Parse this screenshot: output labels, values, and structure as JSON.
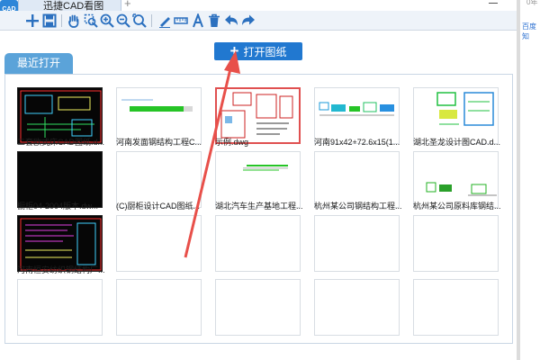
{
  "app": {
    "logo_text": "CAD",
    "tab_title": "迅捷CAD看图",
    "new_tab": "+",
    "side_fragment_1": "0年",
    "side_fragment_2": "百度知"
  },
  "toolbar": {
    "icons": [
      "add-icon",
      "save-icon",
      "pan-hand-icon",
      "zoom-window-icon",
      "zoom-in-icon",
      "zoom-out-icon",
      "zoom-extents-icon",
      "pencil-icon",
      "measure-icon",
      "text-icon",
      "delete-icon",
      "undo-icon",
      "redo-icon"
    ]
  },
  "open_button": {
    "label": "打开图纸",
    "color": "#2178d0"
  },
  "recent": {
    "tab_label": "最近打开",
    "tab_color": "#5ba3d9",
    "files": [
      {
        "name": "二套欧式床CAD图纸.d...",
        "preview": "dark-drawing"
      },
      {
        "name": "河南发面钢结构工程C...",
        "preview": "light-strip"
      },
      {
        "name": "示例.dwg",
        "preview": "selected-plan"
      },
      {
        "name": "河南91x42+72.6x15(1...",
        "preview": "light-multi"
      },
      {
        "name": "湖北圣龙设计图CAD.d...",
        "preview": "light-frame"
      },
      {
        "name": "橱柜04-2004版本.dw...",
        "preview": "dark-blank"
      },
      {
        "name": "(C)厨柜设计CAD图纸...",
        "preview": "empty"
      },
      {
        "name": "湖北汽车生产基地工程...",
        "preview": "light-line"
      },
      {
        "name": "杭州某公司钢结构工程...",
        "preview": "empty"
      },
      {
        "name": "杭州某公司原料库钢结...",
        "preview": "light-small"
      },
      {
        "name": "河南恒安纺织钢结构厂...",
        "preview": "dark-drawing-2"
      }
    ],
    "empty_slots": 9
  },
  "annotation": {
    "arrow_color": "#e8504a"
  }
}
